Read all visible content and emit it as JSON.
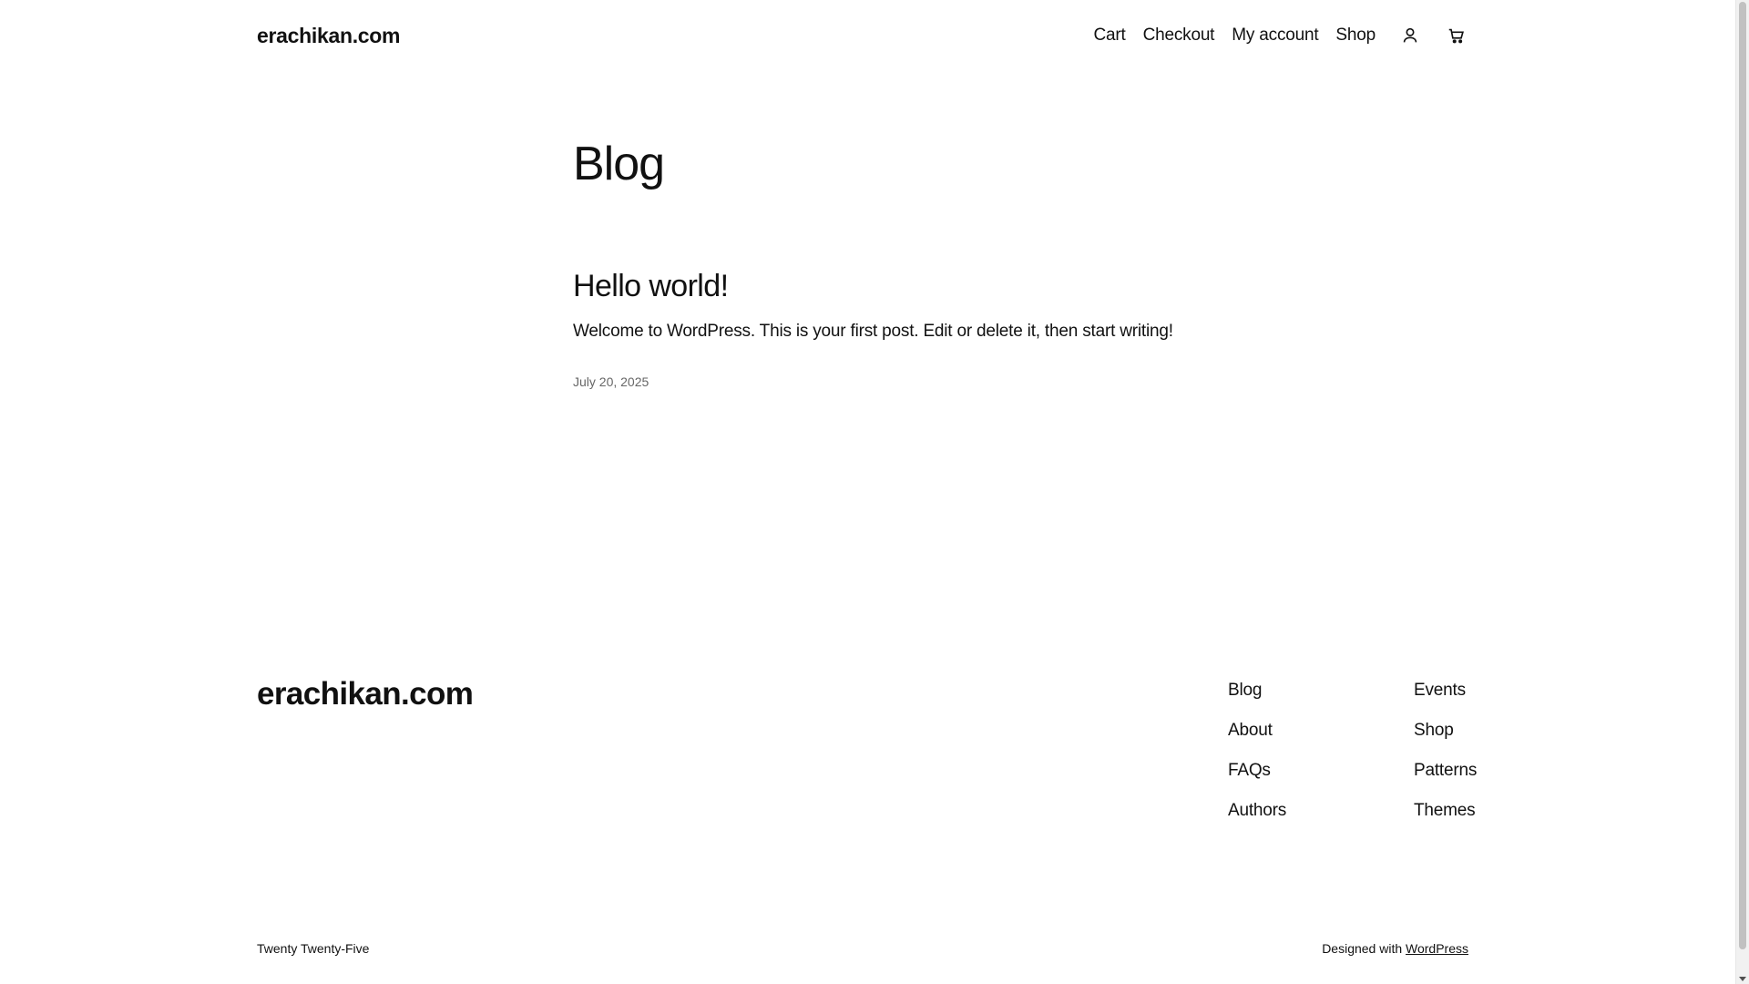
{
  "header": {
    "site_title": "erachikan.com",
    "nav": [
      {
        "label": "Cart"
      },
      {
        "label": "Checkout"
      },
      {
        "label": "My account"
      },
      {
        "label": "Shop"
      }
    ],
    "icons": [
      "user-icon",
      "cart-icon"
    ]
  },
  "main": {
    "page_title": "Blog",
    "post": {
      "title": "Hello world!",
      "excerpt": "Welcome to WordPress. This is your first post. Edit or delete it, then start writing!",
      "date": "July 20, 2025"
    }
  },
  "footer": {
    "site_title": "erachikan.com",
    "col1": [
      "Blog",
      "About",
      "FAQs",
      "Authors"
    ],
    "col2": [
      "Events",
      "Shop",
      "Patterns",
      "Themes"
    ],
    "theme_name": "Twenty Twenty-Five",
    "credit_prefix": "Designed with",
    "credit_link": "WordPress"
  },
  "colors": {
    "text": "#111111",
    "muted": "#666666",
    "background": "#ffffff"
  }
}
